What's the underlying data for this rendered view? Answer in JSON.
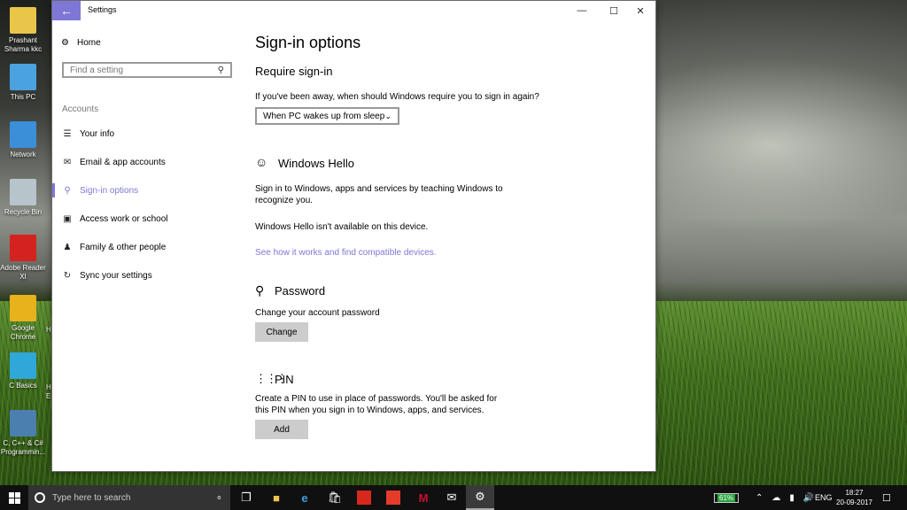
{
  "desktop": {
    "icons": [
      {
        "label": "Prashant Sharma kkc",
        "color": "#e9c64a"
      },
      {
        "label": "This PC",
        "color": "#4aa3e0"
      },
      {
        "label": "Network",
        "color": "#3a8fd8"
      },
      {
        "label": "Recycle Bin",
        "color": "#b8c4cc"
      },
      {
        "label": "Adobe Reader XI",
        "color": "#d4231e"
      },
      {
        "label": "Google Chrome",
        "color": "#e8b21c"
      },
      {
        "label": "C Basics",
        "color": "#2fa7d8"
      },
      {
        "label": "C, C++ & C# Programmin...",
        "color": "#4a7fb0"
      }
    ],
    "peek": [
      "H",
      "H",
      "Er"
    ]
  },
  "window": {
    "title": "Settings",
    "controls": {
      "minimize": "—",
      "maximize": "☐",
      "close": "✕"
    }
  },
  "nav": {
    "home": "Home",
    "search_placeholder": "Find a setting",
    "section": "Accounts",
    "items": [
      {
        "label": "Your info",
        "icon": "person-card-icon"
      },
      {
        "label": "Email & app accounts",
        "icon": "mail-icon"
      },
      {
        "label": "Sign-in options",
        "icon": "key-icon"
      },
      {
        "label": "Access work or school",
        "icon": "briefcase-icon"
      },
      {
        "label": "Family & other people",
        "icon": "person-add-icon"
      },
      {
        "label": "Sync your settings",
        "icon": "sync-icon"
      }
    ],
    "accent": "#7f77d6"
  },
  "content": {
    "title": "Sign-in options",
    "require": {
      "heading": "Require sign-in",
      "question": "If you've been away, when should Windows require you to sign in again?",
      "selected": "When PC wakes up from sleep"
    },
    "hello": {
      "heading": "Windows Hello",
      "desc": "Sign in to Windows, apps and services by teaching Windows to recognize you.",
      "status": "Windows Hello isn't available on this device.",
      "link": "See how it works and find compatible devices."
    },
    "password": {
      "heading": "Password",
      "desc": "Change your account password",
      "button": "Change"
    },
    "pin": {
      "heading": "PIN",
      "desc": "Create a PIN to use in place of passwords. You'll be asked for this PIN when you sign in to Windows, apps, and services.",
      "button": "Add"
    }
  },
  "taskbar": {
    "search_placeholder": "Type here to search",
    "battery": "61%",
    "language": "ENG",
    "time": "18:27",
    "date": "20-09-2017"
  }
}
